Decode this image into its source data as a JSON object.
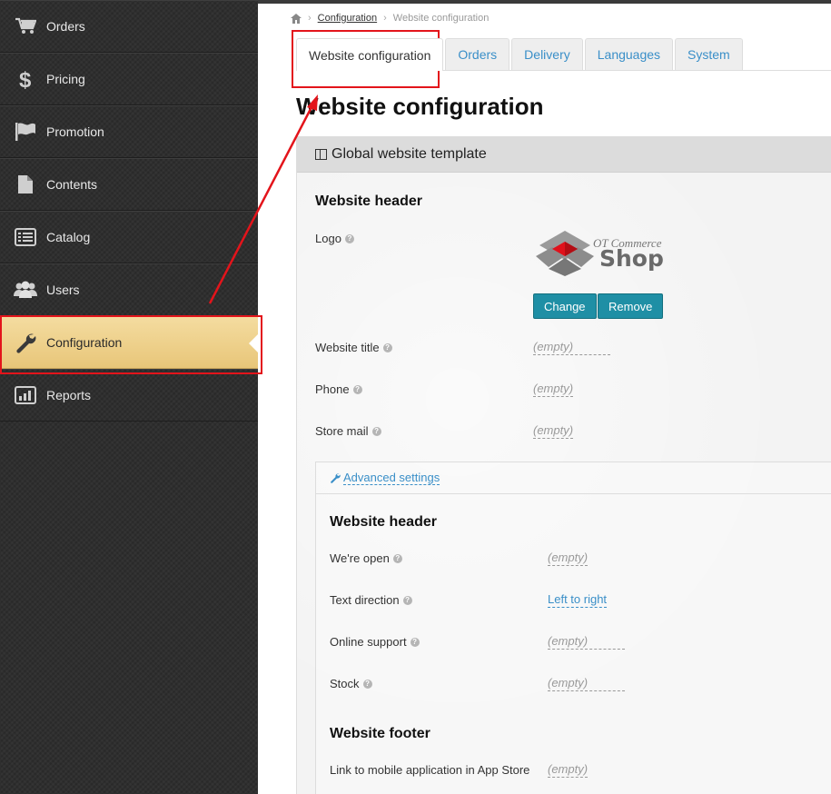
{
  "sidebar": {
    "items": [
      {
        "label": "Orders",
        "icon": "cart-icon"
      },
      {
        "label": "Pricing",
        "icon": "dollar-icon"
      },
      {
        "label": "Promotion",
        "icon": "flag-icon"
      },
      {
        "label": "Contents",
        "icon": "file-icon"
      },
      {
        "label": "Catalog",
        "icon": "list-icon"
      },
      {
        "label": "Users",
        "icon": "users-icon"
      },
      {
        "label": "Configuration",
        "icon": "wrench-icon",
        "active": true
      },
      {
        "label": "Reports",
        "icon": "bar-chart-icon"
      }
    ]
  },
  "breadcrumb": {
    "link": "Configuration",
    "current": "Website configuration",
    "separator": "›"
  },
  "tabs": [
    "Website configuration",
    "Orders",
    "Delivery",
    "Languages",
    "System"
  ],
  "page_title": "Website configuration",
  "panel": {
    "title": "Global website template",
    "header_section": "Website header",
    "logo_label": "Logo",
    "logo": {
      "line1": "OT Commerce",
      "line2": "Shop"
    },
    "buttons": {
      "change": "Change",
      "remove": "Remove"
    },
    "fields": [
      {
        "label": "Website title",
        "value": "(empty)"
      },
      {
        "label": "Phone",
        "value": "(empty)"
      },
      {
        "label": "Store mail",
        "value": "(empty)"
      }
    ],
    "help_glyph": "?",
    "advanced": {
      "link": "Advanced settings",
      "header_section": "Website header",
      "fields": [
        {
          "label": "We're open",
          "value": "(empty)"
        },
        {
          "label": "Text direction",
          "value": "Left to right"
        },
        {
          "label": "Online support",
          "value": "(empty)"
        },
        {
          "label": "Stock",
          "value": "(empty)"
        }
      ],
      "footer_section": "Website footer",
      "footer_fields": [
        {
          "label": "Link to mobile application in App Store",
          "value": "(empty)"
        }
      ]
    }
  },
  "colors": {
    "accent": "#3a8fc8",
    "highlight": "#e3141b",
    "active_nav": "#f0d590",
    "button": "#1f8fa5"
  }
}
